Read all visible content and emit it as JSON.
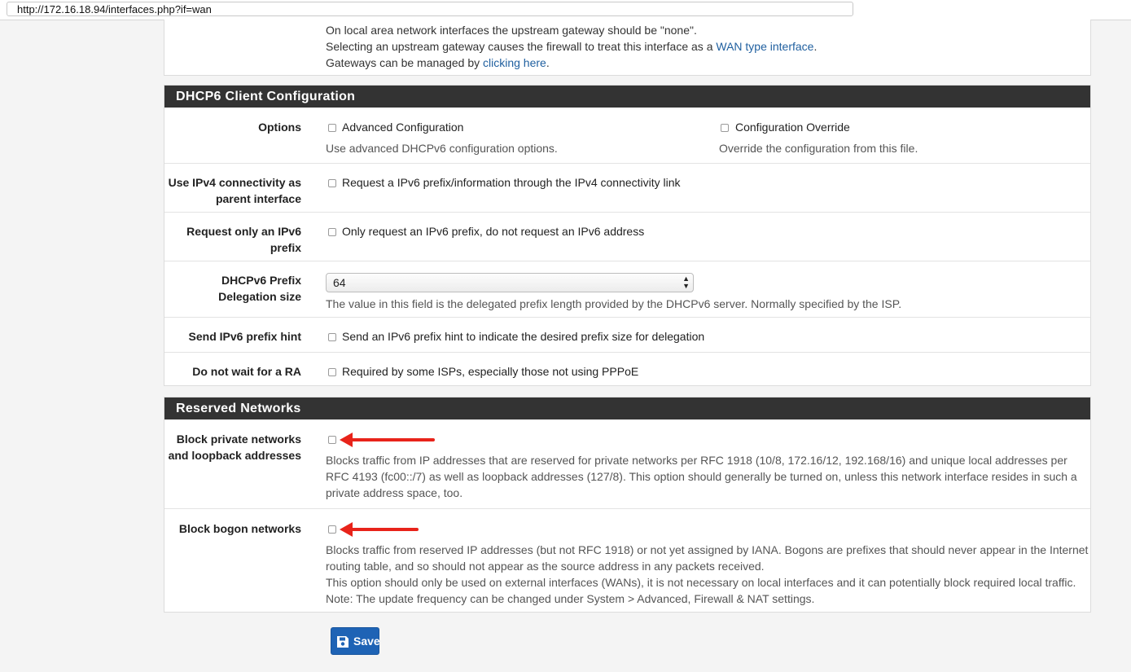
{
  "browser": {
    "url": "http://172.16.18.94/interfaces.php?if=wan"
  },
  "top_panel": {
    "line1": "On local area network interfaces the upstream gateway should be \"none\".",
    "line2_prefix": "Selecting an upstream gateway causes the firewall to treat this interface as a ",
    "line2_link": "WAN type interface",
    "line2_suffix": ".",
    "line3_prefix": "Gateways can be managed by ",
    "line3_link": "clicking here",
    "line3_suffix": "."
  },
  "dhcp6": {
    "title": "DHCP6 Client Configuration",
    "options": {
      "label": "Options",
      "advanced_label": "Advanced Configuration",
      "advanced_help": "Use advanced DHCPv6 configuration options.",
      "override_label": "Configuration Override",
      "override_help": "Override the configuration from this file."
    },
    "ipv4_parent": {
      "label_line1": "Use IPv4 connectivity as",
      "label_line2": "parent interface",
      "checkbox_label": "Request a IPv6 prefix/information through the IPv4 connectivity link"
    },
    "request_prefix": {
      "label_line1": "Request only an IPv6",
      "label_line2": "prefix",
      "checkbox_label": "Only request an IPv6 prefix, do not request an IPv6 address"
    },
    "delegation": {
      "label_line1": "DHCPv6 Prefix",
      "label_line2": "Delegation size",
      "selected": "64",
      "help": "The value in this field is the delegated prefix length provided by the DHCPv6 server. Normally specified by the ISP."
    },
    "prefix_hint": {
      "label": "Send IPv6 prefix hint",
      "checkbox_label": "Send an IPv6 prefix hint to indicate the desired prefix size for delegation"
    },
    "no_wait_ra": {
      "label": "Do not wait for a RA",
      "checkbox_label": "Required by some ISPs, especially those not using PPPoE"
    }
  },
  "reserved": {
    "title": "Reserved Networks",
    "private": {
      "label_line1": "Block private networks",
      "label_line2": "and loopback addresses",
      "help_line1": "Blocks traffic from IP addresses that are reserved for private networks per RFC 1918 (10/8, 172.16/12, 192.168/16) and unique local addresses per",
      "help_line2": "RFC 4193 (fc00::/7) as well as loopback addresses (127/8). This option should generally be turned on, unless this network interface resides in such a",
      "help_line3": "private address space, too."
    },
    "bogon": {
      "label": "Block bogon networks",
      "help_line1": "Blocks traffic from reserved IP addresses (but not RFC 1918) or not yet assigned by IANA. Bogons are prefixes that should never appear in the Internet",
      "help_line2": "routing table, and so should not appear as the source address in any packets received.",
      "help_line3": "This option should only be used on external interfaces (WANs), it is not necessary on local interfaces and it can potentially block required local traffic.",
      "help_line4": "Note: The update frequency can be changed under System > Advanced, Firewall & NAT settings."
    }
  },
  "save_button": {
    "label": "Save",
    "icon": "floppy-disk-icon"
  },
  "colors": {
    "heading_bg": "#333333",
    "link": "#1f5f9f",
    "button": "#1e63b5",
    "annotation_arrow": "#e8231a"
  }
}
